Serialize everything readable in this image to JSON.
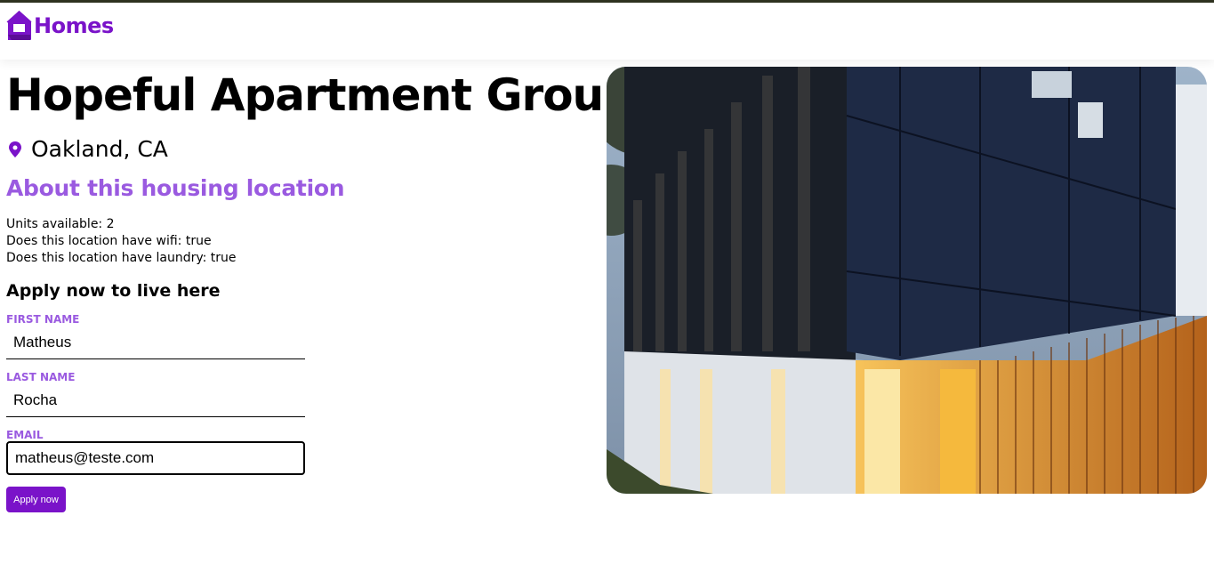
{
  "header": {
    "brand": "Homes",
    "icon": "house-icon"
  },
  "listing": {
    "name": "Hopeful Apartment Group",
    "location": "Oakland, CA",
    "location_icon": "map-pin-icon",
    "about_heading": "About this housing location",
    "units": "Units available: 2",
    "wifi": "Does this location have wifi: true",
    "laundry": "Does this location have laundry: true",
    "image_alt": "Exterior photo of Hopeful Apartment Group"
  },
  "form": {
    "heading": "Apply now to live here",
    "first_name": {
      "label": "FIRST NAME",
      "value": "Matheus"
    },
    "last_name": {
      "label": "LAST NAME",
      "value": "Rocha"
    },
    "email": {
      "label": "EMAIL",
      "value": "matheus@teste.com"
    },
    "submit_label": "Apply now"
  },
  "colors": {
    "brand": "#7a13c9",
    "accent": "#9a5ae0",
    "topline": "#2f3320"
  }
}
